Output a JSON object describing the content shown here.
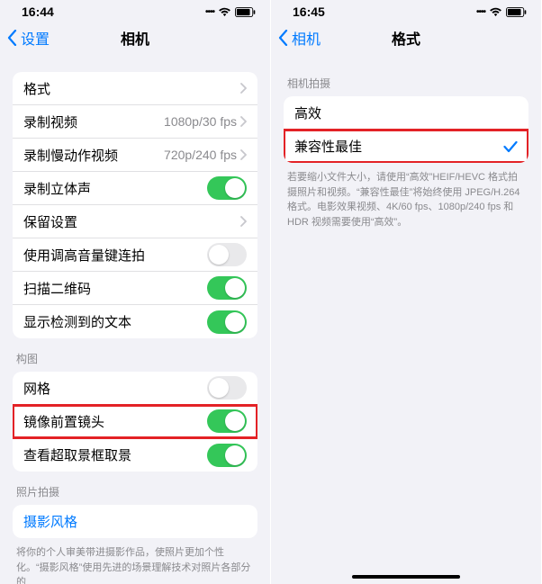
{
  "left": {
    "status": {
      "time": "16:44"
    },
    "nav": {
      "back": "设置",
      "title": "相机"
    },
    "group1": [
      {
        "label": "格式",
        "type": "chevron"
      },
      {
        "label": "录制视频",
        "detail": "1080p/30 fps",
        "type": "chevron"
      },
      {
        "label": "录制慢动作视频",
        "detail": "720p/240 fps",
        "type": "chevron"
      },
      {
        "label": "录制立体声",
        "type": "toggle",
        "on": true
      },
      {
        "label": "保留设置",
        "type": "chevron"
      },
      {
        "label": "使用调高音量键连拍",
        "type": "toggle",
        "on": false
      },
      {
        "label": "扫描二维码",
        "type": "toggle",
        "on": true
      },
      {
        "label": "显示检测到的文本",
        "type": "toggle",
        "on": true
      }
    ],
    "section2_header": "构图",
    "group2": [
      {
        "label": "网格",
        "type": "toggle",
        "on": false
      },
      {
        "label": "镜像前置镜头",
        "type": "toggle",
        "on": true,
        "highlight": true
      },
      {
        "label": "查看超取景框取景",
        "type": "toggle",
        "on": true
      }
    ],
    "section3_header": "照片拍摄",
    "group3": [
      {
        "label": "摄影风格",
        "type": "link"
      }
    ],
    "footer3": "将你的个人审美带进摄影作品，使照片更加个性化。“摄影风格”使用先进的场景理解技术对照片各部分的"
  },
  "right": {
    "status": {
      "time": "16:45"
    },
    "nav": {
      "back": "相机",
      "title": "格式"
    },
    "section1_header": "相机拍摄",
    "group1": [
      {
        "label": "高效",
        "type": "plain"
      },
      {
        "label": "兼容性最佳",
        "type": "check",
        "highlight": true
      }
    ],
    "footer1": "若要缩小文件大小，请使用“高效”HEIF/HEVC 格式拍摄照片和视频。“兼容性最佳”将始终使用 JPEG/H.264格式。电影效果视频、4K/60 fps、1080p/240 fps 和 HDR 视频需要使用“高效”。"
  },
  "colors": {
    "accent": "#007aff",
    "green": "#34c759",
    "grey": "#8a8a8e",
    "highlight": "#e32226"
  }
}
